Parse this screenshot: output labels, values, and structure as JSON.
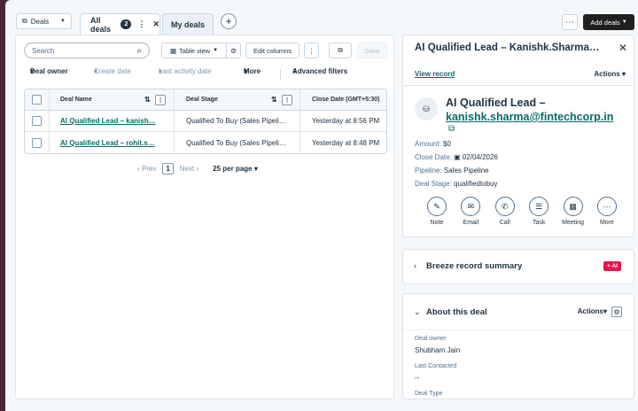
{
  "topbar": {
    "deals_dropdown": "Deals",
    "tabs": [
      {
        "label": "All deals",
        "count": "2"
      },
      {
        "label": "My deals"
      }
    ],
    "add_tab": "+",
    "more": "⋯",
    "add_deals": "Add deals"
  },
  "toolbar": {
    "search_placeholder": "Search",
    "table_view": "Table view",
    "edit_columns": "Edit columns",
    "save": "Save"
  },
  "filters": {
    "owner": "Deal owner",
    "create_date": "Create date",
    "last_activity": "Last activity date",
    "more": "More",
    "advanced": "Advanced filters"
  },
  "table": {
    "columns": [
      "Deal Name",
      "Deal Stage",
      "Close Date (GMT+5:30)"
    ],
    "rows": [
      {
        "name": "AI Qualified Lead – kanish…",
        "stage": "Qualified To Buy (Sales Pipeli…",
        "close": "Yesterday at 8:56 PM"
      },
      {
        "name": "AI Qualified Lead – rohit.s…",
        "stage": "Qualified To Buy (Sales Pipeli…",
        "close": "Yesterday at 8:48 PM"
      }
    ]
  },
  "pager": {
    "prev": "Prev",
    "page": "1",
    "next": "Next",
    "per_page": "25 per page"
  },
  "record": {
    "header_title": "AI Qualified Lead – Kanishk.Sharma…",
    "view_record": "View record",
    "actions": "Actions",
    "title": "AI Qualified Lead –",
    "email": "kanishk.sharma@fintechcorp.in",
    "props": [
      {
        "label": "Amount:",
        "value": "$0"
      },
      {
        "label": "Close Date:",
        "value": "02/04/2026"
      },
      {
        "label": "Pipeline:",
        "value": "Sales Pipeline"
      },
      {
        "label": "Deal Stage:",
        "value": "qualifiedtobuy"
      }
    ],
    "activities": [
      {
        "label": "Note",
        "icon": "note-icon",
        "glyph": "✎"
      },
      {
        "label": "Email",
        "icon": "email-icon",
        "glyph": "✉"
      },
      {
        "label": "Call",
        "icon": "phone-icon",
        "glyph": "✆"
      },
      {
        "label": "Task",
        "icon": "task-icon",
        "glyph": "☰"
      },
      {
        "label": "Meeting",
        "icon": "meeting-icon",
        "glyph": "▦"
      },
      {
        "label": "More",
        "icon": "more-icon",
        "glyph": "⋯"
      }
    ]
  },
  "breeze": {
    "title": "Breeze record summary",
    "badge": "+ AI"
  },
  "about": {
    "title": "About this deal",
    "actions": "Actions",
    "fields": [
      {
        "label": "Deal owner",
        "value": "Shubham Jain"
      },
      {
        "label": "Last Contacted",
        "value": "--"
      },
      {
        "label": "Deal Type",
        "value": ""
      }
    ]
  },
  "colors": {
    "accent_link": "#0a6b63",
    "dark": "#213343",
    "ai_badge": "#e5174c",
    "frame_bg": "#4a2438"
  }
}
